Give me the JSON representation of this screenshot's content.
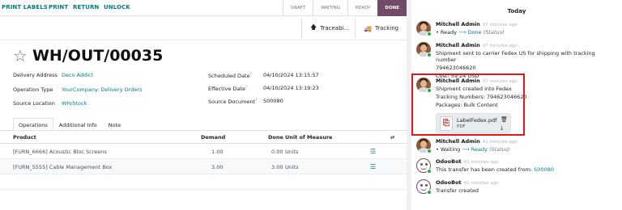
{
  "toolbar": {
    "print_labels": "PRINT LABELS",
    "print": "PRINT",
    "return": "RETURN",
    "unlock": "UNLOCK"
  },
  "status": [
    "DRAFT",
    "WAITING",
    "READY",
    "DONE"
  ],
  "smart_buttons": {
    "traceability": "Traceabi...",
    "tracking": "Tracking"
  },
  "record": {
    "title": "WH/OUT/00035",
    "delivery_address_label": "Delivery Address",
    "delivery_address": "Deco Addict",
    "operation_type_label": "Operation Type",
    "operation_type": "YourCompany: Delivery Orders",
    "source_location_label": "Source Location",
    "source_location": "WH/Stock",
    "scheduled_date_label": "Scheduled Date",
    "scheduled_date": "04/10/2024 13:15:57",
    "effective_date_label": "Effective Date",
    "effective_date": "04/10/2024 13:19:23",
    "source_document_label": "Source Document",
    "source_document": "S00080"
  },
  "tabs": [
    "Operations",
    "Additional Info",
    "Note"
  ],
  "table": {
    "headers": {
      "product": "Product",
      "demand": "Demand",
      "done": "Done",
      "uom": "Unit of Measure"
    },
    "rows": [
      {
        "product": "[FURN_6666] Acoustic Bloc Screens",
        "demand": "1.00",
        "done": "0.00",
        "uom": "Units"
      },
      {
        "product": "[FURN_5555] Cable Management Box",
        "demand": "3.00",
        "done": "3.00",
        "uom": "Units"
      }
    ]
  },
  "chatter": {
    "today": "Today",
    "messages": [
      {
        "author": "Mitchell Admin",
        "time": "37 minutes ago",
        "from": "Ready",
        "to": "Done",
        "field": "(Status)"
      },
      {
        "author": "Mitchell Admin",
        "time": "37 minutes ago",
        "line1": "Shipment sent to carrier Fedex US for shipping with tracking number",
        "line2": "794623046620",
        "line3": "Cost: 59.24 USD"
      },
      {
        "author": "Mitchell Admin",
        "time": "37 minutes ago",
        "line1": "Shipment created into Fedex",
        "line2": "Tracking Numbers: 794623046620",
        "line3": "Packages: Bulk Content",
        "file_name": "LabelFedex.pdf",
        "file_type": "PDF"
      },
      {
        "author": "Mitchell Admin",
        "time": "41 minutes ago",
        "from": "Waiting",
        "to": "Ready",
        "field": "(Status)"
      },
      {
        "author": "OdooBot",
        "time": "41 minutes ago",
        "line1": "This transfer has been created from:",
        "link": "S00080"
      },
      {
        "author": "OdooBot",
        "time": "41 minutes ago",
        "line1": "Transfer created"
      }
    ]
  },
  "colors": {
    "accent": "#017e84",
    "brand": "#714b67",
    "highlight": "#e8141a"
  }
}
